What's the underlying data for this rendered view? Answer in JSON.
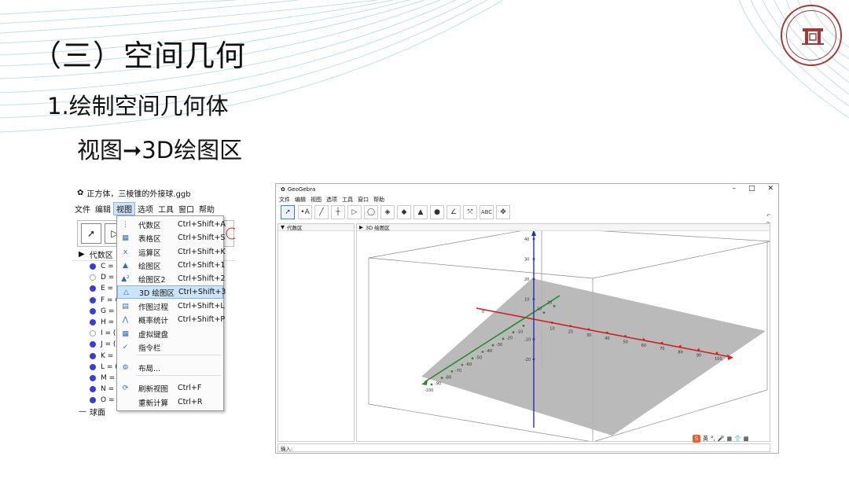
{
  "slide": {
    "title": "（三）空间几何",
    "subtitle": "1.绘制空间几何体",
    "path_text": "视图➞3D绘图区"
  },
  "colors": {
    "seal": "#a33a3a",
    "menu_highlight": "#cce4f7",
    "axis_x": "#cc2222",
    "axis_y": "#2a8a2a",
    "axis_z": "#2233aa",
    "plane": "#b3b3b3"
  },
  "left_window": {
    "file_title": "正方体，三棱锥的外接球.ggb",
    "menu_bar": [
      "文件",
      "编辑",
      "视图",
      "选项",
      "工具",
      "窗口",
      "帮助"
    ],
    "algebra_header": "代数区",
    "algebra_rows": [
      "C =",
      "D =",
      "E =",
      "F = (",
      "G =",
      "H =",
      "I = (",
      "J = (",
      "K =",
      "L = (",
      "M =",
      "N =",
      "O ="
    ],
    "group_label": "球面"
  },
  "view_menu": {
    "items": [
      {
        "label": "代数区",
        "shortcut": "Ctrl+Shift+A",
        "icon": "algebra-icon"
      },
      {
        "label": "表格区",
        "shortcut": "Ctrl+Shift+S",
        "icon": "spreadsheet-icon"
      },
      {
        "label": "运算区",
        "shortcut": "Ctrl+Shift+K",
        "icon": "cas-icon"
      },
      {
        "label": "绘图区",
        "shortcut": "Ctrl+Shift+1",
        "icon": "graphics-icon"
      },
      {
        "label": "绘图区2",
        "shortcut": "Ctrl+Shift+2",
        "icon": "graphics2-icon"
      },
      {
        "label": "3D 绘图区",
        "shortcut": "Ctrl+Shift+3",
        "icon": "graphics3d-icon"
      },
      {
        "label": "作图过程",
        "shortcut": "Ctrl+Shift+L",
        "icon": "construction-icon"
      },
      {
        "label": "概率统计",
        "shortcut": "Ctrl+Shift+P",
        "icon": "probability-icon"
      },
      {
        "label": "虚拟键盘",
        "shortcut": "",
        "icon": "keyboard-icon"
      },
      {
        "label": "指令栏",
        "shortcut": "",
        "icon": "check-icon"
      },
      {
        "label": "布局...",
        "shortcut": "",
        "icon": "gear-icon"
      },
      {
        "label": "刷新视图",
        "shortcut": "Ctrl+F",
        "icon": "refresh-icon"
      },
      {
        "label": "重新计算",
        "shortcut": "Ctrl+R",
        "icon": ""
      }
    ],
    "selected_index": 5
  },
  "right_window": {
    "title": "GeoGebra",
    "menu_bar": [
      "文件",
      "编辑",
      "视图",
      "选项",
      "工具",
      "窗口",
      "帮助"
    ],
    "algebra_header": "代数区",
    "graphics_header": "3D 绘图区",
    "input_label": "输入:",
    "abc_tool": "ABC",
    "undo_marks": [
      "↶",
      "↷"
    ],
    "ime_label": "英"
  },
  "chart_data": {
    "type": "3d-axes",
    "x_ticks": [
      "0",
      "10",
      "20",
      "30",
      "40",
      "50",
      "60",
      "70",
      "80",
      "90",
      "100"
    ],
    "y_ticks": [
      "-100",
      "-90",
      "-80",
      "-70",
      "-60",
      "-50",
      "-40",
      "-30",
      "-20",
      "-10",
      "10",
      "20"
    ],
    "z_ticks": [
      "40",
      "30",
      "20",
      "10",
      "-10",
      "-20"
    ]
  }
}
